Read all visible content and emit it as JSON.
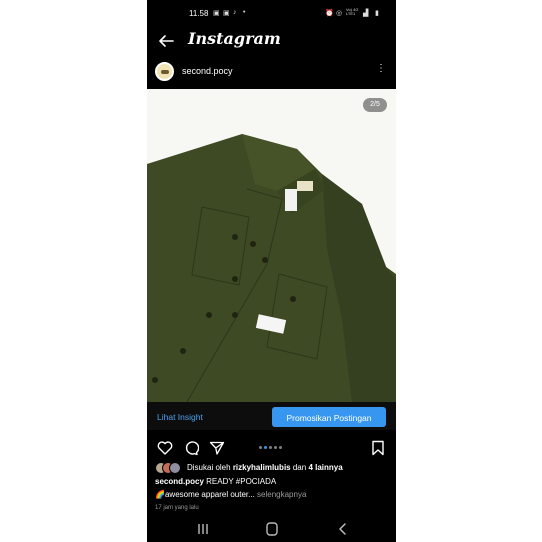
{
  "status_bar": {
    "time": "11.58",
    "left_icons": [
      "photo-icon",
      "facebook-icon",
      "tiktok-icon"
    ],
    "dot": "•",
    "right_icons": [
      "alarm-icon",
      "hotspot-icon",
      "signal-icon",
      "battery-icon"
    ],
    "network_label": "Vo) 4G LTE1"
  },
  "header": {
    "title": "Instagram"
  },
  "post": {
    "username": "second.pocy",
    "more_glyph": "⋮",
    "page_indicator": "2/5",
    "carousel_total": 5,
    "carousel_active": 2
  },
  "insight_bar": {
    "insight_label": "Lihat Insight",
    "promote_label": "Promosikan Postingan",
    "accent_color": "#3797f0"
  },
  "likes": {
    "prefix": "Disukai oleh",
    "user": "rizkyhalimlubis",
    "middle": "dan",
    "others": "4 lainnya"
  },
  "caption": {
    "username": "second.pocy",
    "text": "READY #POCIADA",
    "line2": "🌈awesome apparel outer...",
    "more": "selengkapnya"
  },
  "post_time": "17 jam yang lalu",
  "colors": {
    "jacket": "#3e4a24",
    "background": "#000000"
  }
}
